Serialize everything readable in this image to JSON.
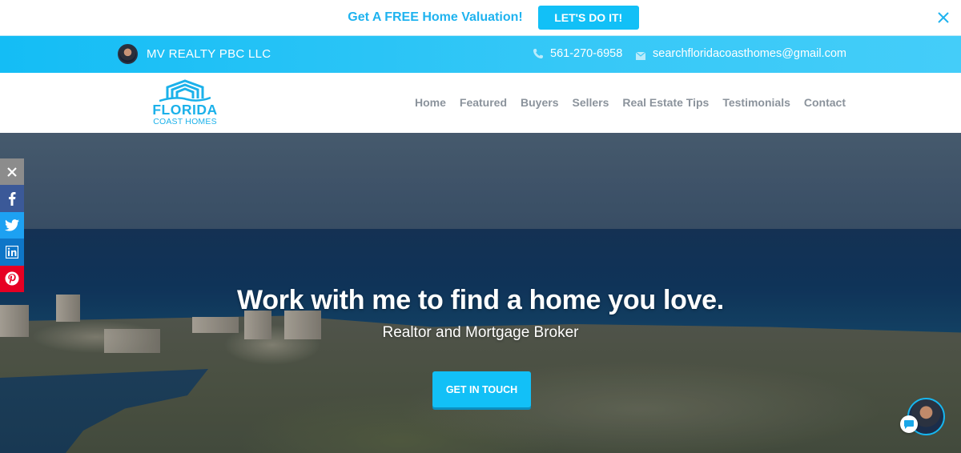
{
  "promo": {
    "text": "Get A FREE Home Valuation!",
    "button_label": "LET'S DO IT!",
    "close_icon": "close-icon"
  },
  "infobar": {
    "agent_name": "MV REALTY PBC LLC",
    "phone": "561-270-6958",
    "email": "searchfloridacoasthomes@gmail.com",
    "phone_icon": "phone-icon",
    "mail_icon": "mail-icon"
  },
  "logo": {
    "line1": "FLORIDA",
    "line2": "COAST HOMES"
  },
  "nav": {
    "items": [
      {
        "label": "Home"
      },
      {
        "label": "Featured"
      },
      {
        "label": "Buyers"
      },
      {
        "label": "Sellers"
      },
      {
        "label": "Real Estate Tips"
      },
      {
        "label": "Testimonials"
      },
      {
        "label": "Contact"
      }
    ]
  },
  "hero": {
    "title": "Work with me to find a home you love.",
    "subtitle": "Realtor and Mortgage Broker",
    "cta_label": "GET IN TOUCH"
  },
  "social": {
    "items": [
      {
        "name": "close",
        "icon": "close-icon"
      },
      {
        "name": "facebook",
        "icon": "facebook-icon"
      },
      {
        "name": "twitter",
        "icon": "twitter-icon"
      },
      {
        "name": "linkedin",
        "icon": "linkedin-icon"
      },
      {
        "name": "pinterest",
        "icon": "pinterest-icon"
      }
    ]
  },
  "chat": {
    "icon": "chat-bubble-icon"
  },
  "colors": {
    "accent": "#12c0f7",
    "brand": "#1bb1ea",
    "nav_text": "#8b939c",
    "facebook": "#3b5998",
    "twitter": "#1da1f2",
    "linkedin": "#0e76c8",
    "pinterest": "#e60023"
  }
}
